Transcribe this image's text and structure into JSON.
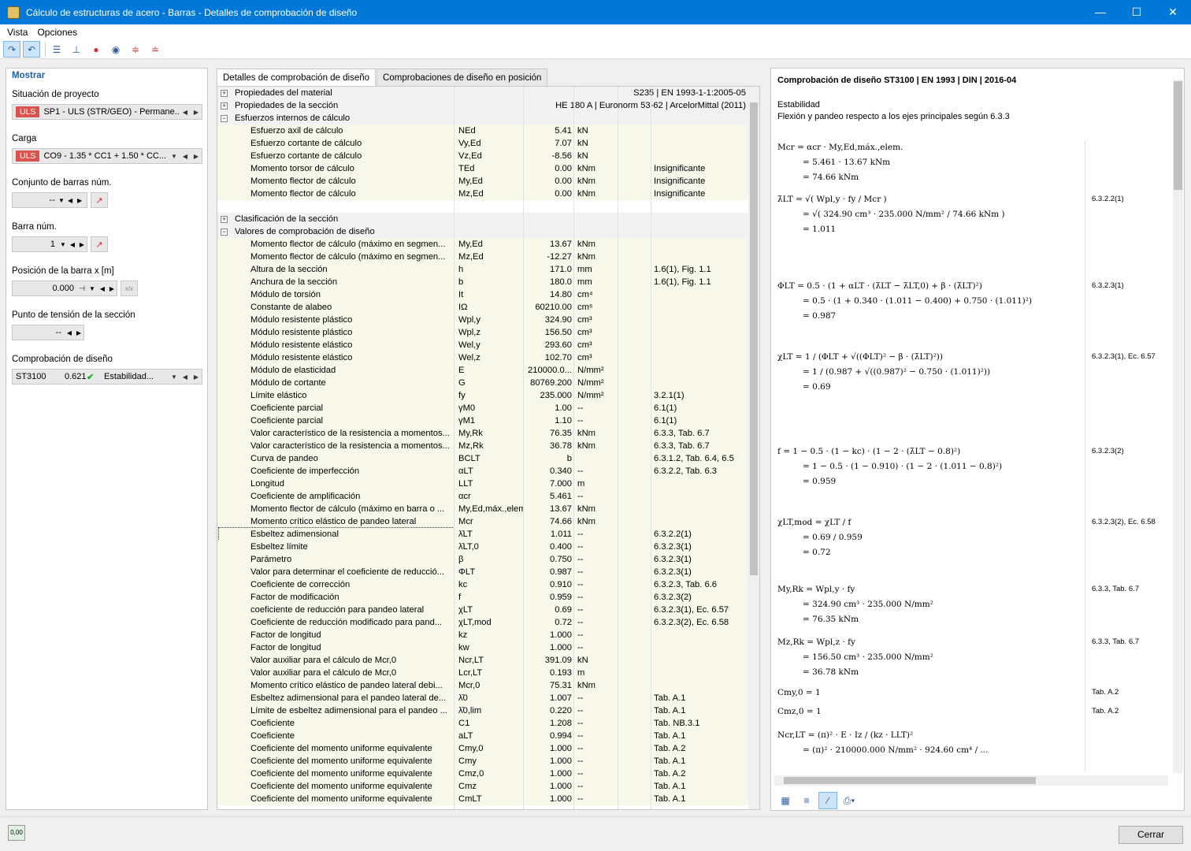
{
  "window": {
    "title": "Cálculo de estructuras de acero - Barras - Detalles de comprobación de diseño"
  },
  "menu": [
    "Vista",
    "Opciones"
  ],
  "left": {
    "header": "Mostrar",
    "situation_label": "Situación de proyecto",
    "situation_badge": "ULS",
    "situation_value": "SP1 - ULS (STR/GEO) - Permane...",
    "load_label": "Carga",
    "load_badge": "ULS",
    "load_value": "CO9 - 1.35 * CC1 + 1.50 * CC...",
    "memberset_label": "Conjunto de barras núm.",
    "memberset_value": "--",
    "member_label": "Barra núm.",
    "member_value": "1",
    "position_label": "Posición de la barra x [m]",
    "position_value": "0.000",
    "stresspoint_label": "Punto de tensión de la sección",
    "stresspoint_value": "--",
    "check_label": "Comprobación de diseño",
    "check_id": "ST3100",
    "check_ratio": "0.621",
    "check_type": "Estabilidad..."
  },
  "tabs": [
    "Detalles de comprobación de diseño",
    "Comprobaciones de diseño en posición"
  ],
  "groups": {
    "material": {
      "label": "Propiedades del material",
      "value": "S235 | EN 1993-1-1:2005-05"
    },
    "section": {
      "label": "Propiedades de la sección",
      "value": "HE 180 A | Euronorm 53-62 | ArcelorMittal (2011)"
    },
    "forces": {
      "label": "Esfuerzos internos de cálculo"
    },
    "classification": {
      "label": "Clasificación de la sección"
    },
    "values": {
      "label": "Valores de comprobación de diseño"
    }
  },
  "forces_rows": [
    {
      "name": "Esfuerzo axil de cálculo",
      "sym": "NEd",
      "val": "5.41",
      "unit": "kN",
      "ref": ""
    },
    {
      "name": "Esfuerzo cortante de cálculo",
      "sym": "Vy,Ed",
      "val": "7.07",
      "unit": "kN",
      "ref": ""
    },
    {
      "name": "Esfuerzo cortante de cálculo",
      "sym": "Vz,Ed",
      "val": "-8.56",
      "unit": "kN",
      "ref": ""
    },
    {
      "name": "Momento torsor de cálculo",
      "sym": "TEd",
      "val": "0.00",
      "unit": "kNm",
      "ref": "Insignificante"
    },
    {
      "name": "Momento flector de cálculo",
      "sym": "My,Ed",
      "val": "0.00",
      "unit": "kNm",
      "ref": "Insignificante"
    },
    {
      "name": "Momento flector de cálculo",
      "sym": "Mz,Ed",
      "val": "0.00",
      "unit": "kNm",
      "ref": "Insignificante"
    }
  ],
  "value_rows": [
    {
      "name": "Momento flector de cálculo (máximo en segmen...",
      "sym": "My,Ed",
      "val": "13.67",
      "unit": "kNm",
      "ref": ""
    },
    {
      "name": "Momento flector de cálculo (máximo en segmen...",
      "sym": "Mz,Ed",
      "val": "-12.27",
      "unit": "kNm",
      "ref": ""
    },
    {
      "name": "Altura de la sección",
      "sym": "h",
      "val": "171.0",
      "unit": "mm",
      "ref": "1.6(1), Fig. 1.1"
    },
    {
      "name": "Anchura de la sección",
      "sym": "b",
      "val": "180.0",
      "unit": "mm",
      "ref": "1.6(1), Fig. 1.1"
    },
    {
      "name": "Módulo de torsión",
      "sym": "It",
      "val": "14.80",
      "unit": "cm⁴",
      "ref": ""
    },
    {
      "name": "Constante de alabeo",
      "sym": "IΩ",
      "val": "60210.00",
      "unit": "cm⁶",
      "ref": ""
    },
    {
      "name": "Módulo resistente plástico",
      "sym": "Wpl,y",
      "val": "324.90",
      "unit": "cm³",
      "ref": ""
    },
    {
      "name": "Módulo resistente plástico",
      "sym": "Wpl,z",
      "val": "156.50",
      "unit": "cm³",
      "ref": ""
    },
    {
      "name": "Módulo resistente elástico",
      "sym": "Wel,y",
      "val": "293.60",
      "unit": "cm³",
      "ref": ""
    },
    {
      "name": "Módulo resistente elástico",
      "sym": "Wel,z",
      "val": "102.70",
      "unit": "cm³",
      "ref": ""
    },
    {
      "name": "Módulo de elasticidad",
      "sym": "E",
      "val": "210000.0...",
      "unit": "N/mm²",
      "ref": ""
    },
    {
      "name": "Módulo de cortante",
      "sym": "G",
      "val": "80769.200",
      "unit": "N/mm²",
      "ref": ""
    },
    {
      "name": "Límite elástico",
      "sym": "fy",
      "val": "235.000",
      "unit": "N/mm²",
      "ref": "3.2.1(1)"
    },
    {
      "name": "Coeficiente parcial",
      "sym": "γM0",
      "val": "1.00",
      "unit": "--",
      "ref": "6.1(1)"
    },
    {
      "name": "Coeficiente parcial",
      "sym": "γM1",
      "val": "1.10",
      "unit": "--",
      "ref": "6.1(1)"
    },
    {
      "name": "Valor característico de la resistencia a momentos...",
      "sym": "My,Rk",
      "val": "76.35",
      "unit": "kNm",
      "ref": "6.3.3, Tab. 6.7"
    },
    {
      "name": "Valor característico de la resistencia a momentos...",
      "sym": "Mz,Rk",
      "val": "36.78",
      "unit": "kNm",
      "ref": "6.3.3, Tab. 6.7"
    },
    {
      "name": "Curva de pandeo",
      "sym": "BCLT",
      "val": "b",
      "unit": "",
      "ref": "6.3.1.2, Tab. 6.4, 6.5"
    },
    {
      "name": "Coeficiente de imperfección",
      "sym": "αLT",
      "val": "0.340",
      "unit": "--",
      "ref": "6.3.2.2, Tab. 6.3"
    },
    {
      "name": "Longitud",
      "sym": "LLT",
      "val": "7.000",
      "unit": "m",
      "ref": ""
    },
    {
      "name": "Coeficiente de amplificación",
      "sym": "αcr",
      "val": "5.461",
      "unit": "--",
      "ref": ""
    },
    {
      "name": "Momento flector de cálculo (máximo en barra o ...",
      "sym": "My,Ed,máx.,elem.",
      "val": "13.67",
      "unit": "kNm",
      "ref": ""
    },
    {
      "name": "Momento crítico elástico de pandeo lateral",
      "sym": "Mcr",
      "val": "74.66",
      "unit": "kNm",
      "ref": ""
    },
    {
      "name": "Esbeltez adimensional",
      "sym": "λ̄LT",
      "val": "1.011",
      "unit": "--",
      "ref": "6.3.2.2(1)"
    },
    {
      "name": "Esbeltez límite",
      "sym": "λ̄LT,0",
      "val": "0.400",
      "unit": "--",
      "ref": "6.3.2.3(1)"
    },
    {
      "name": "Parámetro",
      "sym": "β",
      "val": "0.750",
      "unit": "--",
      "ref": "6.3.2.3(1)"
    },
    {
      "name": "Valor para determinar el coeficiente de reducció...",
      "sym": "ΦLT",
      "val": "0.987",
      "unit": "--",
      "ref": "6.3.2.3(1)"
    },
    {
      "name": "Coeficiente de corrección",
      "sym": "kc",
      "val": "0.910",
      "unit": "--",
      "ref": "6.3.2.3, Tab. 6.6"
    },
    {
      "name": "Factor de modificación",
      "sym": "f",
      "val": "0.959",
      "unit": "--",
      "ref": "6.3.2.3(2)"
    },
    {
      "name": "coeficiente de reducción para pandeo lateral",
      "sym": "χLT",
      "val": "0.69",
      "unit": "--",
      "ref": "6.3.2.3(1), Ec. 6.57"
    },
    {
      "name": "Coeficiente de reducción modificado para pand...",
      "sym": "χLT,mod",
      "val": "0.72",
      "unit": "--",
      "ref": "6.3.2.3(2), Ec. 6.58"
    },
    {
      "name": "Factor de longitud",
      "sym": "kz",
      "val": "1.000",
      "unit": "--",
      "ref": ""
    },
    {
      "name": "Factor de longitud",
      "sym": "kw",
      "val": "1.000",
      "unit": "--",
      "ref": ""
    },
    {
      "name": "Valor auxiliar para el cálculo de Mcr,0",
      "sym": "Ncr,LT",
      "val": "391.09",
      "unit": "kN",
      "ref": ""
    },
    {
      "name": "Valor auxiliar para el cálculo de Mcr,0",
      "sym": "Lcr,LT",
      "val": "0.193",
      "unit": "m",
      "ref": ""
    },
    {
      "name": "Momento crítico elástico de pandeo lateral debi...",
      "sym": "Mcr,0",
      "val": "75.31",
      "unit": "kNm",
      "ref": ""
    },
    {
      "name": "Esbeltez adimensional para el pandeo lateral de...",
      "sym": "λ̄0",
      "val": "1.007",
      "unit": "--",
      "ref": "Tab. A.1"
    },
    {
      "name": "Límite de esbeltez adimensional para el pandeo ...",
      "sym": "λ̄0,lim",
      "val": "0.220",
      "unit": "--",
      "ref": "Tab. A.1"
    },
    {
      "name": "Coeficiente",
      "sym": "C1",
      "val": "1.208",
      "unit": "--",
      "ref": "Tab. NB.3.1"
    },
    {
      "name": "Coeficiente",
      "sym": "aLT",
      "val": "0.994",
      "unit": "--",
      "ref": "Tab. A.1"
    },
    {
      "name": "Coeficiente del momento uniforme equivalente",
      "sym": "Cmy,0",
      "val": "1.000",
      "unit": "--",
      "ref": "Tab. A.2"
    },
    {
      "name": "Coeficiente del momento uniforme equivalente",
      "sym": "Cmy",
      "val": "1.000",
      "unit": "--",
      "ref": "Tab. A.1"
    },
    {
      "name": "Coeficiente del momento uniforme equivalente",
      "sym": "Cmz,0",
      "val": "1.000",
      "unit": "--",
      "ref": "Tab. A.2"
    },
    {
      "name": "Coeficiente del momento uniforme equivalente",
      "sym": "Cmz",
      "val": "1.000",
      "unit": "--",
      "ref": "Tab. A.1"
    },
    {
      "name": "Coeficiente del momento uniforme equivalente",
      "sym": "CmLT",
      "val": "1.000",
      "unit": "--",
      "ref": "Tab. A.1"
    }
  ],
  "report": {
    "title": "Comprobación de diseño ST3100 | EN 1993 | DIN | 2016-04",
    "section": "Estabilidad",
    "subtitle": "Flexión y pandeo respecto a los ejes principales según 6.3.3",
    "equations": [
      {
        "lines": [
          "Mcr  =  αcr · My,Ed,máx.,elem.",
          "=  5.461 · 13.67 kNm",
          "=  74.66 kNm"
        ],
        "ref": ""
      },
      {
        "lines": [
          "λ̄LT  =  √( Wpl,y · fy / Mcr )",
          "=  √( 324.90 cm³ · 235.000 N/mm² / 74.66 kNm )",
          "=  1.011"
        ],
        "ref": "6.3.2.2(1)"
      },
      {
        "lines": [
          "ΦLT  =  0.5 · (1 + αLT · (λ̄LT − λ̄LT,0) + β · (λ̄LT)²)",
          "=  0.5 · (1 + 0.340 · (1.011 − 0.400) + 0.750 · (1.011)²)",
          "=  0.987"
        ],
        "ref": "6.3.2.3(1)"
      },
      {
        "lines": [
          "χLT  =  1 / (ΦLT + √((ΦLT)² − β · (λ̄LT)²))",
          "=  1 / (0.987 + √((0.987)² − 0.750 · (1.011)²))",
          "=  0.69"
        ],
        "ref": "6.3.2.3(1), Ec. 6.57"
      },
      {
        "lines": [
          "f  =  1 − 0.5 · (1 − kc) · (1 − 2 · (λ̄LT − 0.8)²)",
          "=  1 − 0.5 · (1 − 0.910) · (1 − 2 · (1.011 − 0.8)²)",
          "=  0.959"
        ],
        "ref": "6.3.2.3(2)"
      },
      {
        "lines": [
          "χLT,mod  =  χLT / f",
          "=  0.69 / 0.959",
          "=  0.72"
        ],
        "ref": "6.3.2.3(2), Ec. 6.58"
      },
      {
        "lines": [
          "My,Rk  =  Wpl,y · fy",
          "=  324.90 cm³ · 235.000 N/mm²",
          "=  76.35 kNm"
        ],
        "ref": "6.3.3, Tab. 6.7"
      },
      {
        "lines": [
          "Mz,Rk  =  Wpl,z · fy",
          "=  156.50 cm³ · 235.000 N/mm²",
          "=  36.78 kNm"
        ],
        "ref": "6.3.3, Tab. 6.7"
      },
      {
        "lines": [
          "Cmy,0  =  1"
        ],
        "ref": "Tab. A.2"
      },
      {
        "lines": [
          "Cmz,0  =  1"
        ],
        "ref": "Tab. A.2"
      },
      {
        "lines": [
          "Ncr,LT  =  (π)² · E · Iz / (kz · LLT)²",
          "=  (π)² · 210000.000 N/mm² · 924.60 cm⁴ / ..."
        ],
        "ref": ""
      }
    ]
  },
  "footer": {
    "close": "Cerrar",
    "calc_icon": "0,00"
  },
  "colors": {
    "titlebar": "#0078d7",
    "uls_badge": "#d9534f",
    "accent": "#1a5fa0"
  }
}
